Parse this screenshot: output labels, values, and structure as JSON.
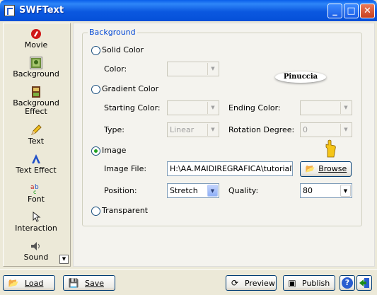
{
  "window": {
    "title": "SWFText",
    "minimize_glyph": "_",
    "maximize_glyph": "□",
    "close_glyph": "✕"
  },
  "sidebar": {
    "items": [
      {
        "label": "Movie",
        "icon": "movie-icon"
      },
      {
        "label": "Background",
        "icon": "background-icon",
        "active": true
      },
      {
        "label": "Background Effect",
        "icon": "background-effect-icon"
      },
      {
        "label": "Text",
        "icon": "text-icon"
      },
      {
        "label": "Text Effect",
        "icon": "text-effect-icon"
      },
      {
        "label": "Font",
        "icon": "font-icon"
      },
      {
        "label": "Interaction",
        "icon": "interaction-icon"
      },
      {
        "label": "Sound",
        "icon": "sound-icon"
      }
    ],
    "scroll_glyph": "▼"
  },
  "background_panel": {
    "group_title": "Background",
    "solid_color": {
      "label": "Solid Color",
      "checked": false,
      "color_label": "Color:"
    },
    "gradient_color": {
      "label": "Gradient Color",
      "checked": false,
      "starting_color_label": "Starting Color:",
      "ending_color_label": "Ending Color:",
      "type_label": "Type:",
      "type_value": "Linear",
      "rotation_label": "Rotation Degree:",
      "rotation_value": "0"
    },
    "image": {
      "label": "Image",
      "checked": true,
      "file_label": "Image File:",
      "file_value": "H:\\AA.MAIDIREGRAFICA\\tutorial\\m",
      "browse_label": "Browse",
      "position_label": "Position:",
      "position_value": "Stretch",
      "quality_label": "Quality:",
      "quality_value": "80"
    },
    "transparent": {
      "label": "Transparent",
      "checked": false
    }
  },
  "watermark": "Pinuccia",
  "toolbar": {
    "load_label": "Load",
    "save_label": "Save",
    "preview_label": "Preview",
    "publish_label": "Publish",
    "help_glyph": "?"
  },
  "colors": {
    "titlebar": "#0A5FEB",
    "group_title": "#0046D5",
    "radio_checked": "#21A121",
    "window_bg": "#ECE9D8"
  }
}
